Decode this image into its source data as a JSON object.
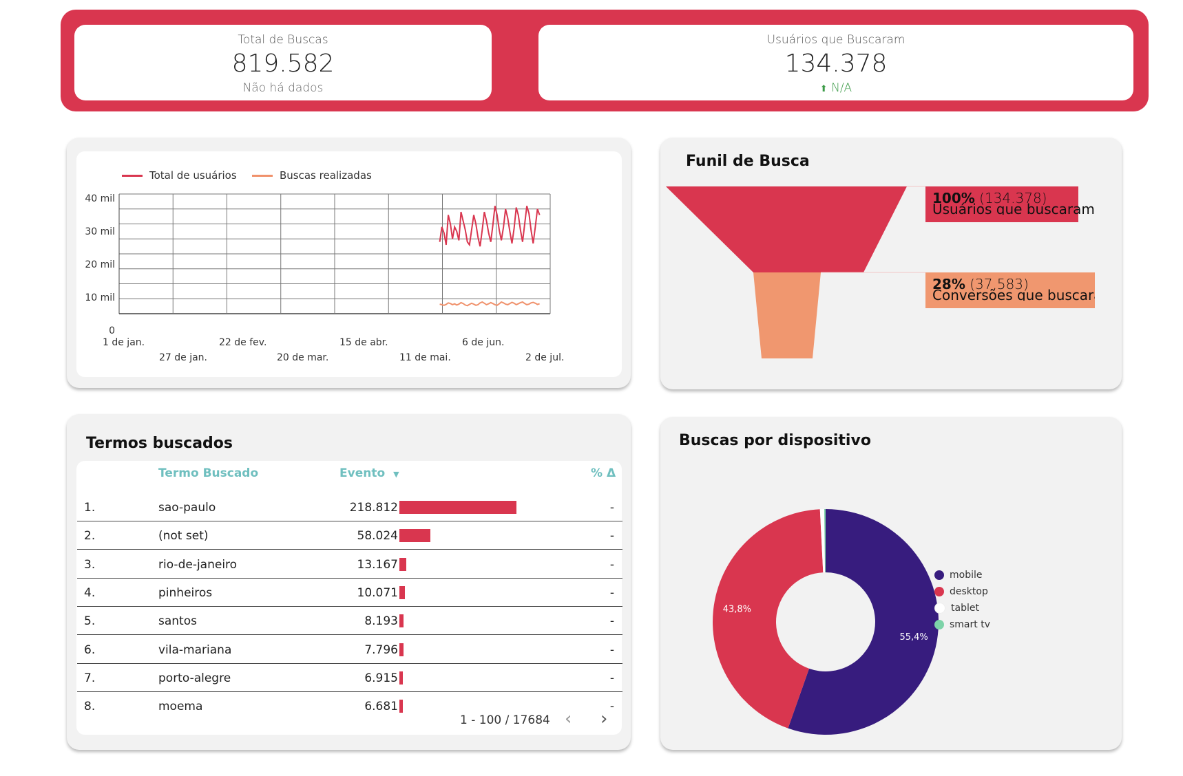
{
  "kpis": {
    "total_buscas": {
      "label": "Total de Buscas",
      "value": "819.582",
      "sub": "Não há dados"
    },
    "usuarios_buscaram": {
      "label": "Usuários que Buscaram",
      "value": "134.378",
      "sub": "N/A",
      "sub_icon": "up-arrow-icon"
    }
  },
  "line_chart": {
    "legend": [
      {
        "name": "Total de usuários",
        "color": "#d9364f"
      },
      {
        "name": "Buscas realizadas",
        "color": "#f0916b"
      }
    ],
    "y_ticks": [
      "40 mil",
      "30 mil",
      "20 mil",
      "10 mil",
      "0"
    ],
    "x_ticks_top": [
      "1 de jan.",
      "22 de fev.",
      "15 de abr.",
      "6 de jun."
    ],
    "x_ticks_bottom": [
      "27 de jan.",
      "20 de mar.",
      "11 de mai.",
      "2 de jul."
    ]
  },
  "chart_data": {
    "type": "line",
    "xlabel": "",
    "ylabel": "",
    "ylim": [
      0,
      40000
    ],
    "x": [
      "2023-01-01",
      "2023-07-23"
    ],
    "x_range_note": "",
    "series": [
      {
        "name": "Total de usuários",
        "start_date": "2023-06-01",
        "values": [
          24000,
          29000,
          27000,
          23000,
          33000,
          30000,
          25000,
          29000,
          27500,
          24500,
          34000,
          31000,
          28000,
          24000,
          23000,
          28000,
          33000,
          30000,
          25500,
          22500,
          28000,
          34000,
          31000,
          27000,
          24000,
          29500,
          36000,
          33000,
          28000,
          24500,
          29000,
          35000,
          32000,
          27500,
          23500,
          28500,
          35500,
          33000,
          28000,
          24000,
          30000,
          36000,
          33500,
          28000,
          23500,
          29000,
          35000,
          33000
        ]
      },
      {
        "name": "Buscas realizadas",
        "start_date": "2023-06-01",
        "values": [
          3200,
          3000,
          2800,
          3100,
          3600,
          3400,
          3000,
          3300,
          2900,
          3200,
          3700,
          3400,
          2900,
          2700,
          3100,
          3500,
          3200,
          2800,
          3000,
          3600,
          3900,
          3500,
          3000,
          3300,
          3700,
          3400,
          3000,
          2800,
          3300,
          3900,
          3600,
          3200,
          3000,
          3400,
          3800,
          3500,
          3000,
          3300,
          3700,
          3900,
          3400,
          3000,
          3200,
          3600,
          3800,
          3500,
          3100,
          3300
        ]
      }
    ]
  },
  "funnel": {
    "title": "Funil de Busca",
    "stages": [
      {
        "pct": "100%",
        "count": "(134.378)",
        "name": "Usuários que buscaram",
        "color": "#d9364f",
        "share": 1.0
      },
      {
        "pct": "28%",
        "count": "(37.583)",
        "name": "Conversões que buscaram",
        "color": "#f0976f",
        "share": 0.28
      }
    ]
  },
  "terms_table": {
    "title": "Termos buscados",
    "headers": {
      "term": "Termo Buscado",
      "event": "Evento",
      "delta": "% Δ"
    },
    "rows": [
      {
        "idx": "1.",
        "term": "sao-paulo",
        "value": "218.812",
        "num": 218812,
        "delta": "-"
      },
      {
        "idx": "2.",
        "term": "(not set)",
        "value": "58.024",
        "num": 58024,
        "delta": "-"
      },
      {
        "idx": "3.",
        "term": "rio-de-janeiro",
        "value": "13.167",
        "num": 13167,
        "delta": "-"
      },
      {
        "idx": "4.",
        "term": "pinheiros",
        "value": "10.071",
        "num": 10071,
        "delta": "-"
      },
      {
        "idx": "5.",
        "term": "santos",
        "value": "8.193",
        "num": 8193,
        "delta": "-"
      },
      {
        "idx": "6.",
        "term": "vila-mariana",
        "value": "7.796",
        "num": 7796,
        "delta": "-"
      },
      {
        "idx": "7.",
        "term": "porto-alegre",
        "value": "6.915",
        "num": 6915,
        "delta": "-"
      },
      {
        "idx": "8.",
        "term": "moema",
        "value": "6.681",
        "num": 6681,
        "delta": "-"
      }
    ],
    "pagination": "1 - 100 / 17684"
  },
  "device_chart": {
    "title": "Buscas por dispositivo",
    "slices": [
      {
        "name": "mobile",
        "value": 55.4,
        "label": "55,4%",
        "color": "#371c7e"
      },
      {
        "name": "desktop",
        "value": 43.8,
        "label": "43,8%",
        "color": "#d9364f"
      },
      {
        "name": "tablet",
        "value": 0.6,
        "label": "",
        "color": "#ffffff"
      },
      {
        "name": "smart tv",
        "value": 0.2,
        "label": "",
        "color": "#7dd3a8"
      }
    ]
  }
}
